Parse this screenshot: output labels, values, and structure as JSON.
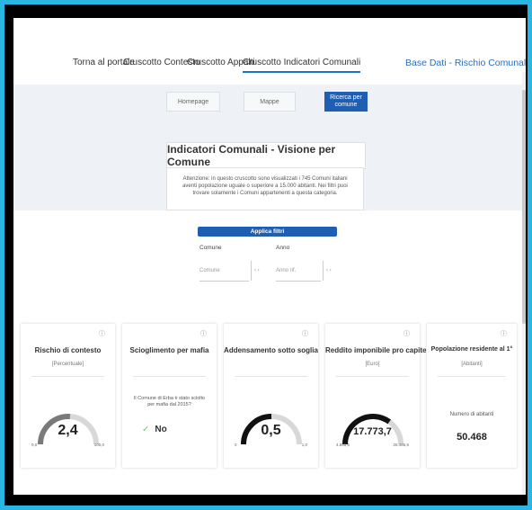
{
  "nav": {
    "items": [
      {
        "label": "Torna al portale"
      },
      {
        "label": "Cruscotto Contesto"
      },
      {
        "label": "Cruscotto Appalti"
      },
      {
        "label": "Cruscotto Indicatori Comunali"
      }
    ],
    "brand": "Base Dati - Rischio Comunale"
  },
  "tabs": {
    "homepage": "Homepage",
    "mappe": "Mappe",
    "ricerca": "Ricerca per comune"
  },
  "header": {
    "title": "Indicatori Comunali - Visione per Comune",
    "info": "Attenzione: in questo cruscotto sono visualizzati i 745 Comuni italiani aventi popolazione uguale o superiore a 15.000 abitanti. Nei filtri puoi trovare solamente i Comuni appartenenti a questa categoria."
  },
  "filters": {
    "apply": "Applica filtri",
    "comune_label": "Comune",
    "anno_label": "Anno",
    "comune_placeholder": "Comune",
    "anno_placeholder": "Anno rif."
  },
  "cards": {
    "rischio": {
      "title": "Rischio di contesto",
      "sub": "[Percentuale]",
      "value": "2,4",
      "min": "0,0",
      "max": "100,0",
      "fraction": 0.52
    },
    "mafia": {
      "title": "Scioglimento per mafia",
      "desc": "Il Comune di Erba è stato sciolto per mafia dal 2015?",
      "answer": "No"
    },
    "adden": {
      "title": "Addensamento sotto soglia",
      "value": "0,5",
      "min": "0",
      "max": "1,0",
      "fraction": 0.5
    },
    "reddito": {
      "title": "Reddito imponibile pro capite",
      "sub": "[Euro]",
      "value": "17.773,7",
      "min": "4.855,6",
      "max": "28.485,6",
      "fraction": 0.7
    },
    "pop": {
      "title": "Popolazione residente al 1°",
      "sub": "[Abitanti]",
      "label": "Numero di abitanti",
      "value": "50.468"
    }
  },
  "colors": {
    "primary": "#1f5fb3",
    "brand": "#2a6fbf",
    "frame": "#000000",
    "background": "#29b6e3"
  },
  "icons": {
    "info": "info-icon",
    "check": "check-icon"
  }
}
